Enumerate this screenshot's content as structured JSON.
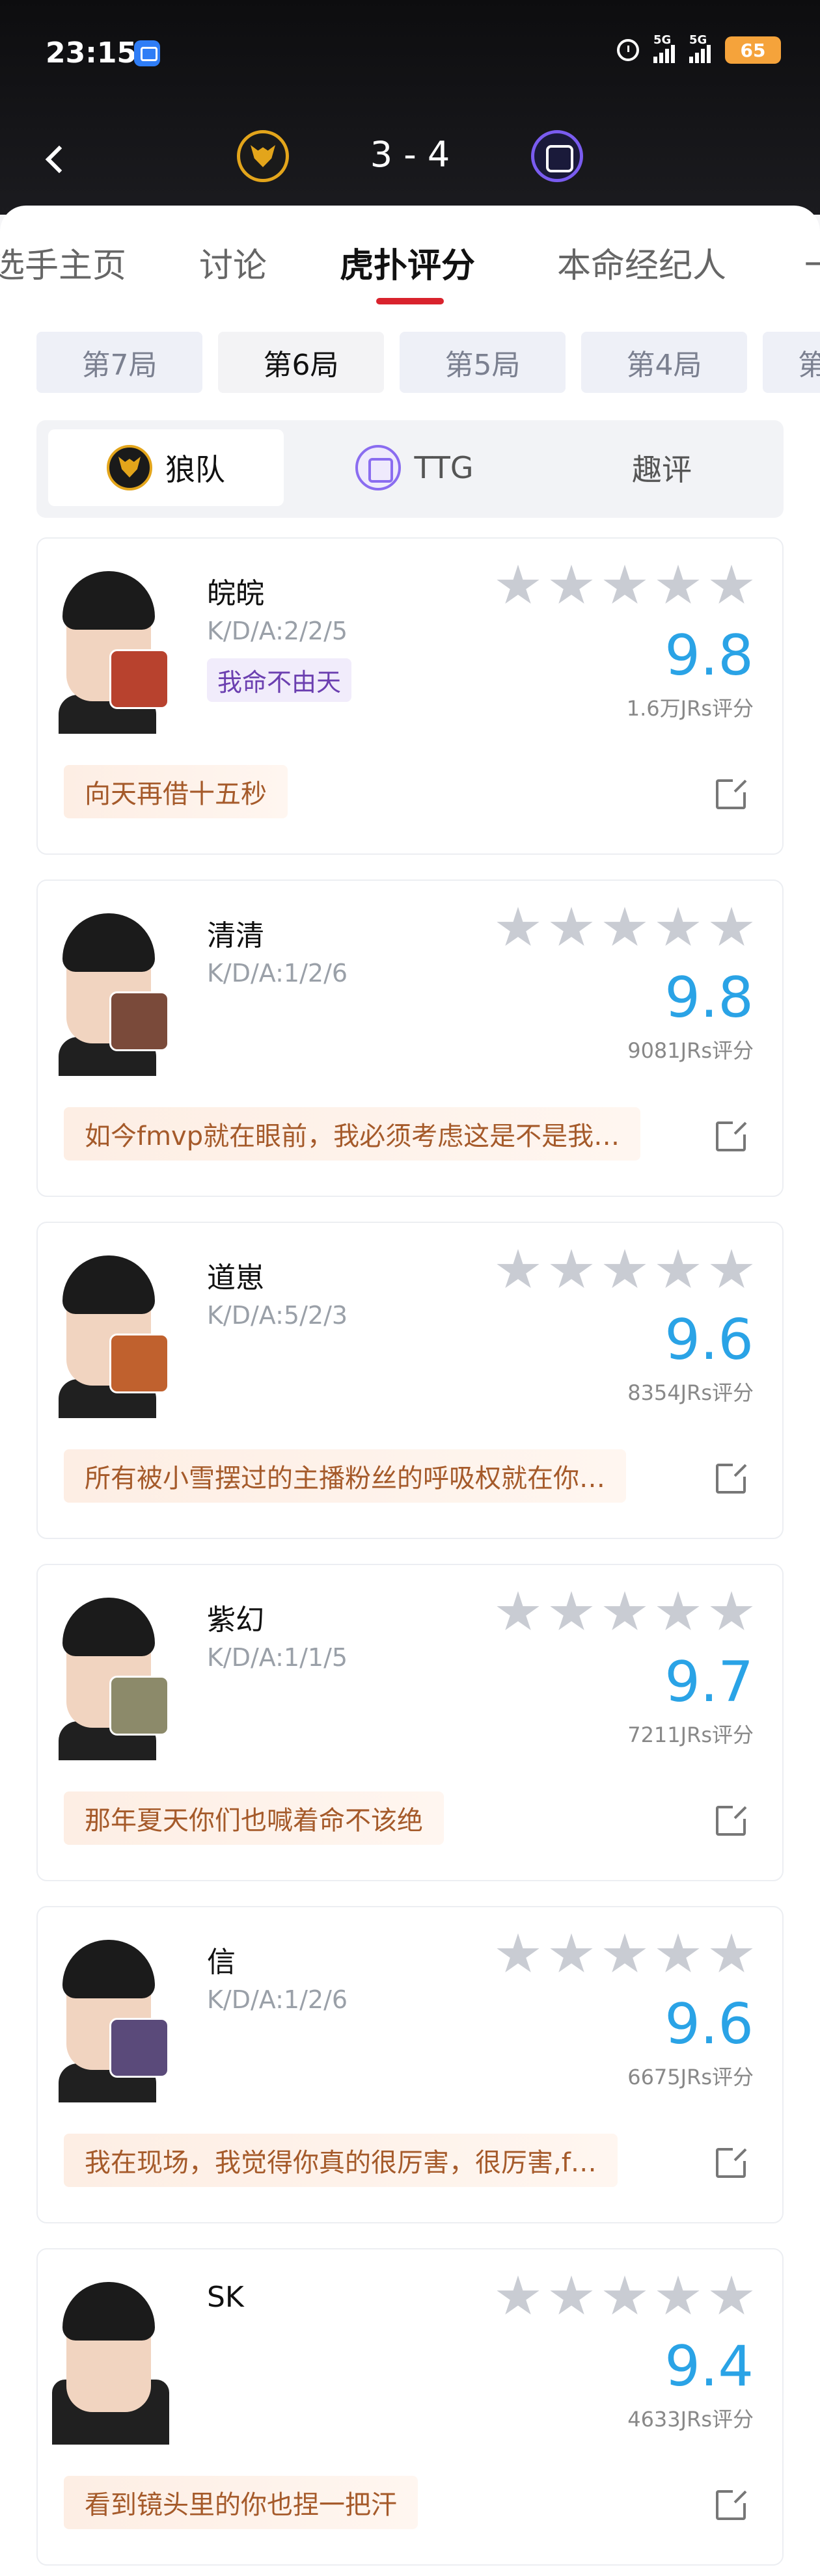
{
  "status_bar": {
    "time": "23:15",
    "signal_labels": [
      "5G",
      "5G"
    ],
    "battery": "65"
  },
  "match": {
    "score": "3 - 4",
    "home_team_icon": "wolves-logo-icon",
    "away_team_icon": "ttg-logo-icon"
  },
  "tabs": [
    {
      "label": "选手主页",
      "active": false
    },
    {
      "label": "讨论",
      "active": false
    },
    {
      "label": "虎扑评分",
      "active": true
    },
    {
      "label": "本命经纪人",
      "active": false
    },
    {
      "label": "一",
      "active": false
    }
  ],
  "rounds": [
    {
      "label": "第7局",
      "active": false
    },
    {
      "label": "第6局",
      "active": true
    },
    {
      "label": "第5局",
      "active": false
    },
    {
      "label": "第4局",
      "active": false
    },
    {
      "label": "第",
      "active": false
    }
  ],
  "team_switch": [
    {
      "label": "狼队",
      "active": true
    },
    {
      "label": "TTG",
      "active": false
    },
    {
      "label": "趣评",
      "active": false
    }
  ],
  "colors": {
    "accent_red": "#d9232d",
    "rating_blue": "#2aa3e6",
    "comment_text": "#a55a2a",
    "star_gray": "#c9ccd3"
  },
  "players": [
    {
      "name": "皖皖",
      "kda": "K/D/A:2/2/5",
      "badge": "我命不由天",
      "rating": "9.8",
      "votes": "1.6万JRs评分",
      "comment": "向天再借十五秒",
      "hero_color": "#b8422e"
    },
    {
      "name": "清清",
      "kda": "K/D/A:1/2/6",
      "badge": "",
      "rating": "9.8",
      "votes": "9081JRs评分",
      "comment": "如今fmvp就在眼前，我必须考虑这是不是我…",
      "hero_color": "#7a4a3a"
    },
    {
      "name": "道崽",
      "kda": "K/D/A:5/2/3",
      "badge": "",
      "rating": "9.6",
      "votes": "8354JRs评分",
      "comment": "所有被小雪摆过的主播粉丝的呼吸权就在你…",
      "hero_color": "#c0612e"
    },
    {
      "name": "紫幻",
      "kda": "K/D/A:1/1/5",
      "badge": "",
      "rating": "9.7",
      "votes": "7211JRs评分",
      "comment": "那年夏天你们也喊着命不该绝",
      "hero_color": "#8c8a6a"
    },
    {
      "name": "信",
      "kda": "K/D/A:1/2/6",
      "badge": "",
      "rating": "9.6",
      "votes": "6675JRs评分",
      "comment": "我在现场，我觉得你真的很厉害，很厉害,f…",
      "hero_color": "#5a4a7a"
    },
    {
      "name": "SK",
      "kda": "",
      "badge": "",
      "rating": "9.4",
      "votes": "4633JRs评分",
      "comment": "看到镜头里的你也捏一把汗",
      "hero_color": ""
    }
  ]
}
